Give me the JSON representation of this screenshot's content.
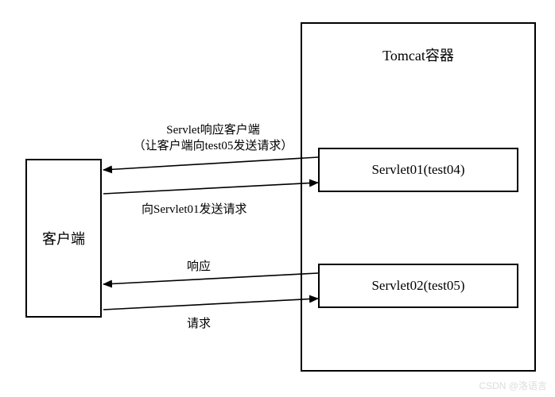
{
  "client_label": "客户端",
  "container_label": "Tomcat容器",
  "servlet01_label": "Servlet01(test04)",
  "servlet02_label": "Servlet02(test05)",
  "arrows": {
    "response_redirect_line1": "Servlet响应客户端",
    "response_redirect_line2": "（让客户端向test05发送请求）",
    "request_to_servlet01": "向Servlet01发送请求",
    "response_from_servlet02": "响应",
    "request_to_servlet02": "请求"
  },
  "watermark": "CSDN @洛语言"
}
